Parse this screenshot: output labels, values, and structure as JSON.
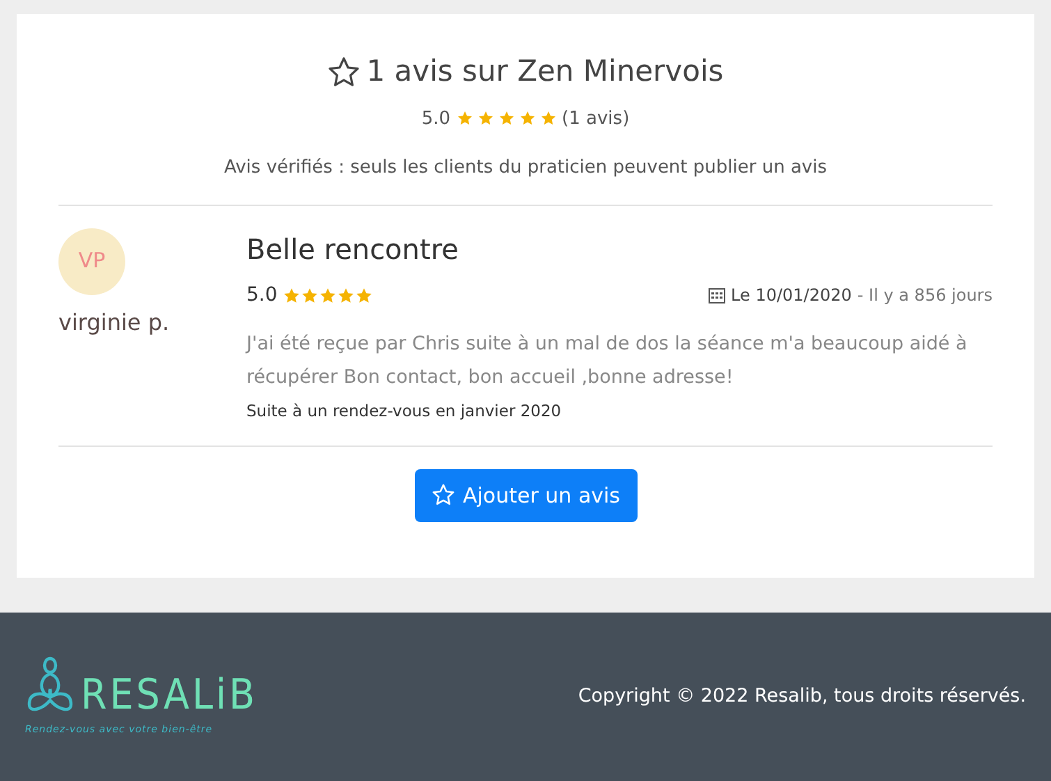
{
  "header": {
    "title": "1 avis sur Zen Minervois",
    "score": "5.0",
    "stars": 5,
    "count": "(1 avis)",
    "notice": "Avis vérifiés : seuls les clients du praticien peuvent publier un avis"
  },
  "reviews": [
    {
      "initials": "VP",
      "author": "virginie p.",
      "title": "Belle rencontre",
      "score": "5.0",
      "stars": 5,
      "date": "Le 10/01/2020",
      "ago": "- Il y a 856 jours",
      "text": "J'ai été reçue par Chris suite à un mal de dos la séance m'a beaucoup aidé à récupérer Bon contact, bon accueil ,bonne adresse!",
      "context": "Suite à un rendez-vous en janvier 2020"
    }
  ],
  "add_button": "Ajouter un avis",
  "footer": {
    "logo": "RESALiB",
    "tagline": "Rendez-vous avec votre bien-être",
    "copyright": "Copyright © 2022 Resalib, tous droits réservés."
  }
}
